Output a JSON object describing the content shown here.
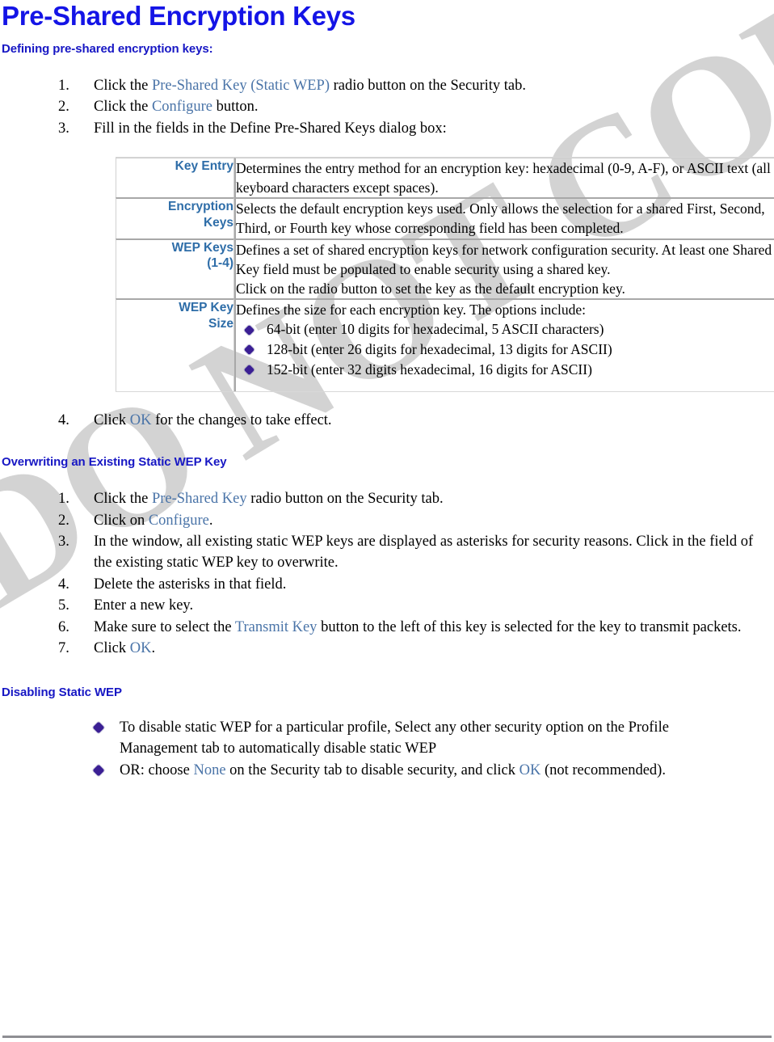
{
  "document": {
    "title": "Pre-Shared Encryption Keys",
    "watermark": "DO NOT COPY"
  },
  "sections": [
    {
      "heading": "Defining pre-shared encryption keys:",
      "steps": [
        {
          "num": "1.",
          "parts": [
            {
              "text": "Click the ",
              "link": false
            },
            {
              "text": "Pre-Shared Key (Static WEP)",
              "link": true
            },
            {
              "text": " radio button on the Security tab.",
              "link": false
            }
          ]
        },
        {
          "num": "2.",
          "parts": [
            {
              "text": "Click the ",
              "link": false
            },
            {
              "text": "Configure",
              "link": true
            },
            {
              "text": " button.",
              "link": false
            }
          ]
        },
        {
          "num": "3.",
          "parts": [
            {
              "text": "Fill in the fields in the Define Pre-Shared Keys dialog box:",
              "link": false
            }
          ]
        }
      ]
    }
  ],
  "table": {
    "rows": [
      {
        "label": "Key Entry",
        "paragraphs": [
          "Determines the entry method for an encryption key: hexadecimal (0-9, A-F), or ASCII text (all keyboard characters except spaces)."
        ],
        "bullets": []
      },
      {
        "label": "Encryption Keys",
        "label_lines": [
          "Encryption",
          "Keys"
        ],
        "paragraphs": [
          "Selects the default encryption keys used. Only allows the selection for a shared First, Second, Third, or Fourth key whose corresponding field has been completed."
        ],
        "bullets": []
      },
      {
        "label": "WEP Keys (1-4)",
        "label_lines": [
          "WEP Keys",
          "(1-4)"
        ],
        "paragraphs": [
          "Defines a set of shared encryption keys for network configuration security. At least one Shared Key field must be populated to enable security using a shared key.",
          "Click on the radio button to set the key as the default encryption key."
        ],
        "bullets": []
      },
      {
        "label": "WEP Key Size",
        "label_lines": [
          "WEP Key",
          "Size"
        ],
        "paragraphs": [
          "Defines the size for each encryption key. The options include:"
        ],
        "bullets": [
          "64-bit (enter 10 digits for hexadecimal, 5 ASCII characters)",
          "128-bit (enter 26 digits for hexadecimal, 13 digits for ASCII)",
          "152-bit (enter 32 digits hexadecimal, 16 digits for ASCII)"
        ]
      }
    ]
  },
  "step4": {
    "num": "4.",
    "parts": [
      {
        "text": "Click ",
        "link": false
      },
      {
        "text": "OK",
        "link": true
      },
      {
        "text": " for the changes to take effect.",
        "link": false
      }
    ]
  },
  "section2": {
    "heading": "Overwriting an Existing Static WEP Key",
    "steps": [
      {
        "num": "1.",
        "parts": [
          {
            "text": "Click the ",
            "link": false
          },
          {
            "text": "Pre-Shared Key",
            "link": true
          },
          {
            "text": " radio button on the Security tab.",
            "link": false
          }
        ]
      },
      {
        "num": "2.",
        "parts": [
          {
            "text": "Click on ",
            "link": false
          },
          {
            "text": "Configure",
            "link": true
          },
          {
            "text": ".",
            "link": false
          }
        ]
      },
      {
        "num": "3.",
        "parts": [
          {
            "text": "In the window, all existing static WEP keys are displayed as asterisks for security reasons. Click in the field of the  existing static WEP key to overwrite.",
            "link": false
          }
        ]
      },
      {
        "num": "4.",
        "parts": [
          {
            "text": "Delete the asterisks in that field.",
            "link": false
          }
        ]
      },
      {
        "num": "5.",
        "parts": [
          {
            "text": "Enter a new key.",
            "link": false
          }
        ]
      },
      {
        "num": "6.",
        "parts": [
          {
            "text": "Make sure to select the ",
            "link": false
          },
          {
            "text": "Transmit Key",
            "link": true
          },
          {
            "text": " button to the left of this key is selected for the key to transmit packets.",
            "link": false
          }
        ]
      },
      {
        "num": "7.",
        "parts": [
          {
            "text": "Click ",
            "link": false
          },
          {
            "text": "OK",
            "link": true
          },
          {
            "text": ".",
            "link": false
          }
        ]
      }
    ]
  },
  "section3": {
    "heading": "Disabling Static WEP",
    "bullets": [
      {
        "parts": [
          {
            "text": "To disable static WEP for a particular profile, Select any other security option on the Profile Management tab to automatically disable static WEP",
            "link": false
          }
        ]
      },
      {
        "parts": [
          {
            "text": "OR: choose ",
            "link": false
          },
          {
            "text": "None",
            "link": true
          },
          {
            "text": " on the Security tab to disable security, and click ",
            "link": false
          },
          {
            "text": "OK",
            "link": true
          },
          {
            "text": " (not recommended).",
            "link": false
          }
        ]
      }
    ]
  },
  "colors": {
    "title": "#1414e6",
    "heading": "#1717c4",
    "link": "#4a74a8",
    "table_label": "#2e6da8",
    "bullet": "#3b1f94",
    "watermark": "#cfcfcf"
  }
}
